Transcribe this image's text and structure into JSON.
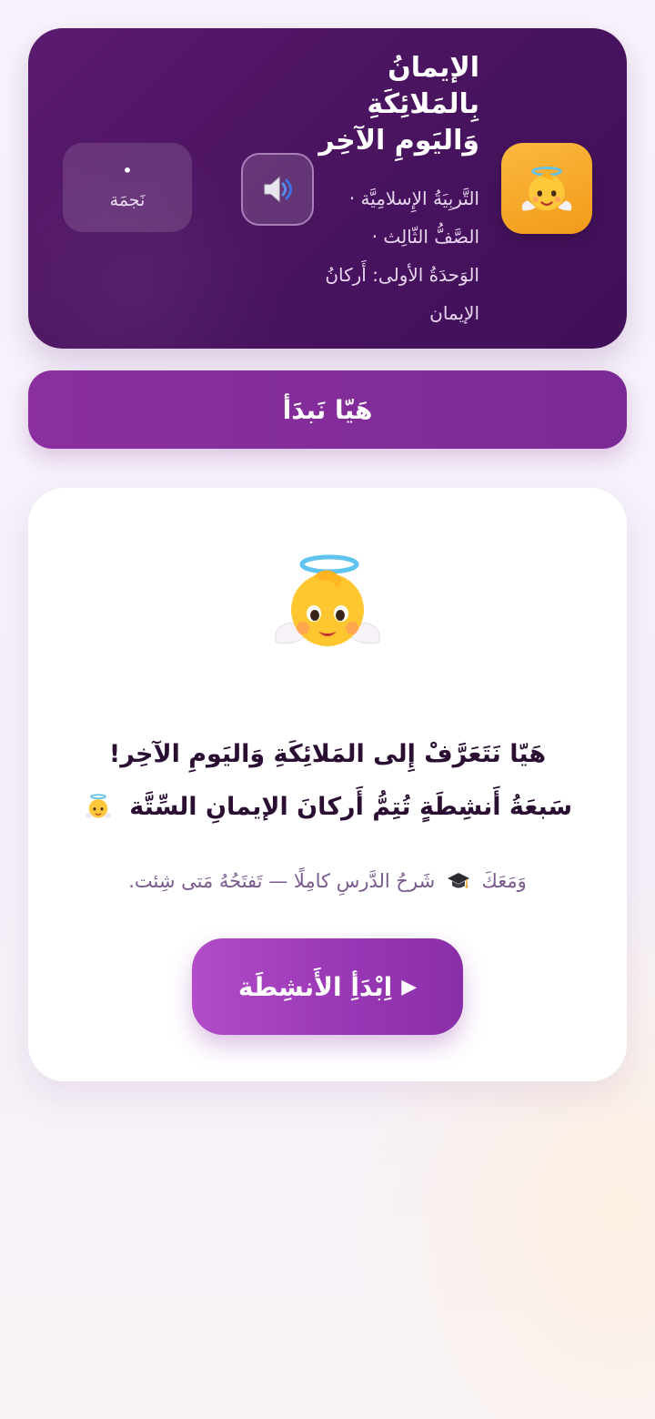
{
  "header": {
    "title_lines": [
      "الإيمانُ",
      "بِالمَلائِكَةِ",
      "وَاليَومِ الآخِر"
    ],
    "subtitle_lines": [
      "التَّربِيَةُ الإِسلامِيَّة ·",
      "الصَّفُّ الثّالِث ·",
      "الوَحدَةُ الأولى: أَركانُ",
      "الإيمان"
    ],
    "app_icon": "baby-angel-emoji",
    "sound_icon": "speaker-icon",
    "stars": {
      "count": "•",
      "label": "نَجمَة"
    }
  },
  "start_bar": {
    "label": "هَيّا نَبدَأ"
  },
  "intro": {
    "hero_icon": "baby-angel-emoji",
    "headline_line1": "هَيّا نَتَعَرَّفْ إِلى المَلائِكَةِ وَاليَومِ الآخِر!",
    "headline_line2": "سَبعَةُ أَنشِطَةٍ تُتِمُّ أَركانَ الإيمانِ السِّتَّة",
    "sub_part1": "وَمَعَكَ",
    "sub_part2": "شَرحُ الدَّرسِ كامِلًا — تَفتَحُهُ مَتى شِئت.",
    "cap_icon": "graduation-cap-icon",
    "cta": {
      "play_glyph": "▶",
      "label": "اِبْدَأِ الأَنشِطَة"
    }
  },
  "colors": {
    "header_bg": "#4b1460",
    "accent": "#8b2fa0",
    "cta": "#a942c0",
    "icon_bg": "#f6a623"
  }
}
